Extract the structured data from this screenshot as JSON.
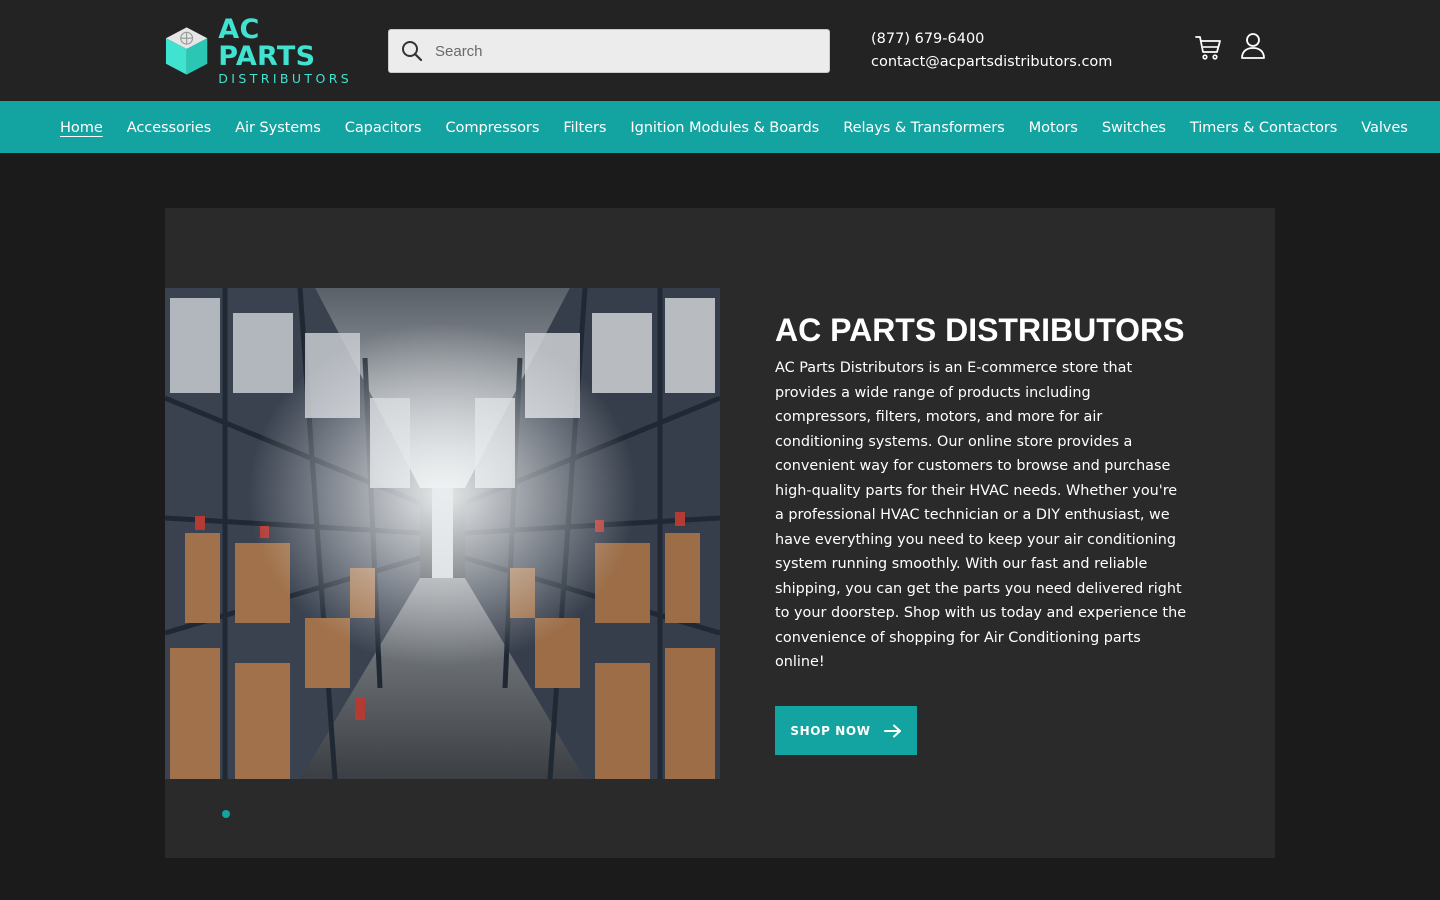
{
  "brand": {
    "name": "AC PARTS",
    "tagline": "DISTRIBUTORS",
    "accent_color": "#3fe3cf"
  },
  "search": {
    "placeholder": "Search",
    "value": ""
  },
  "contact": {
    "phone": "(877) 679-6400",
    "email": "contact@acpartsdistributors.com"
  },
  "header_icons": [
    "cart-icon",
    "account-icon"
  ],
  "nav": {
    "items": [
      {
        "label": "Home",
        "active": true
      },
      {
        "label": "Accessories"
      },
      {
        "label": "Air Systems"
      },
      {
        "label": "Capacitors"
      },
      {
        "label": "Compressors"
      },
      {
        "label": "Filters"
      },
      {
        "label": "Ignition Modules & Boards"
      },
      {
        "label": "Relays & Transformers"
      },
      {
        "label": "Motors"
      },
      {
        "label": "Switches"
      },
      {
        "label": "Timers & Contactors"
      },
      {
        "label": "Valves"
      }
    ],
    "bg_color": "#13a3a0"
  },
  "hero": {
    "title": "AC PARTS DISTRIBUTORS",
    "description": "AC Parts Distributors is an E-commerce store that provides a wide range of products including compressors, filters, motors, and more for air conditioning systems. Our online store provides a convenient way for customers to browse and purchase high-quality parts for their HVAC needs. Whether you're a professional HVAC technician or a DIY enthusiast, we have everything you need to keep your air conditioning system running smoothly. With our fast and reliable shipping, you can get the parts you need delivered right to your doorstep. Shop with us today and experience the convenience of shopping for Air Conditioning parts online!",
    "cta_label": "SHOP NOW",
    "image_subject": "warehouse-aisle-photo",
    "slides_total": 1,
    "active_slide": 1
  }
}
